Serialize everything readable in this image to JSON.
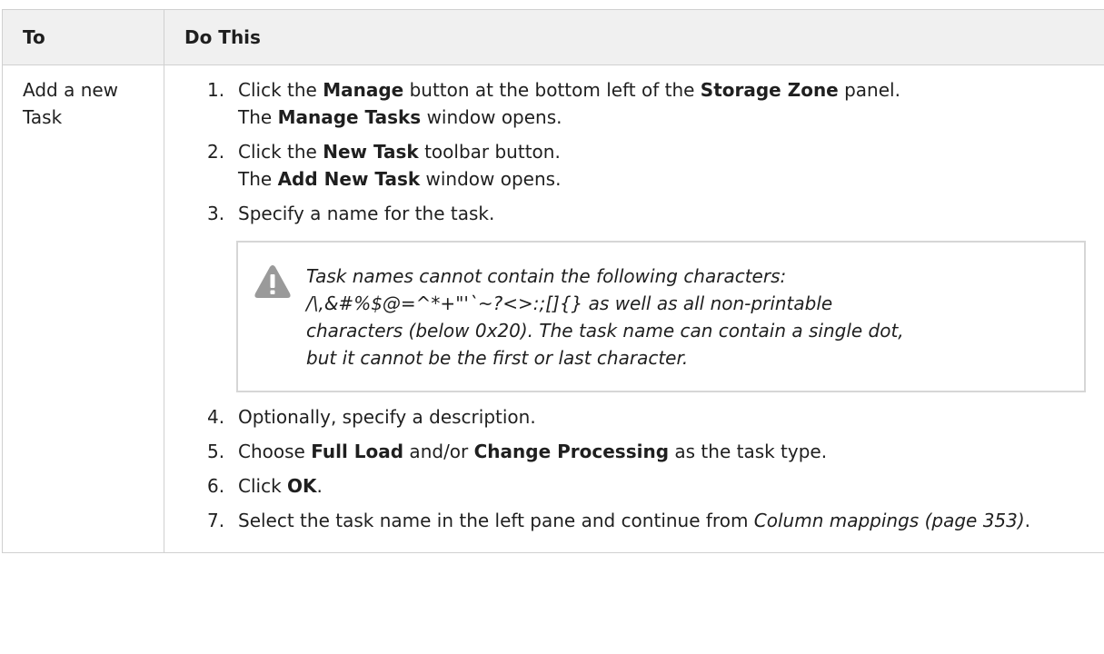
{
  "table": {
    "header": {
      "col1": "To",
      "col2": "Do This"
    },
    "row": {
      "task": "Add a new Task",
      "steps": [
        {
          "num": "1.",
          "p1": "Click the ",
          "b1": "Manage",
          "p2": " button at the bottom left of the ",
          "b2": "Storage Zone",
          "p3": " panel.",
          "p4": "The ",
          "b3": "Manage Tasks",
          "p5": " window opens."
        },
        {
          "num": "2.",
          "p1": "Click the ",
          "b1": "New Task",
          "p2": " toolbar button.",
          "p3": "The ",
          "b2": "Add New Task",
          "p4": " window opens."
        },
        {
          "num": "3.",
          "text": "Specify a name for the task."
        },
        {
          "num": "4.",
          "text": "Optionally, specify a description."
        },
        {
          "num": "5.",
          "p1": "Choose ",
          "b1": "Full Load",
          "p2": " and/or ",
          "b2": "Change Processing",
          "p3": " as the task type."
        },
        {
          "num": "6.",
          "p1": "Click ",
          "b1": "OK",
          "p2": "."
        },
        {
          "num": "7.",
          "p1": "Select the task name in the left pane and continue from ",
          "i1": "Column mappings (page 353)",
          "p2": "."
        }
      ],
      "warning": {
        "l1": "Task names cannot contain the following characters:",
        "l2": "/\\,&#%$@=^*+\"'`~?<>:;[]{} as well as all non-printable",
        "l3": "characters (below 0x20). The task name can contain a single dot,",
        "l4": "but it cannot be the first or last character.",
        "icon": "warning-triangle-icon",
        "icon_color": "#9a9a9a"
      }
    }
  }
}
